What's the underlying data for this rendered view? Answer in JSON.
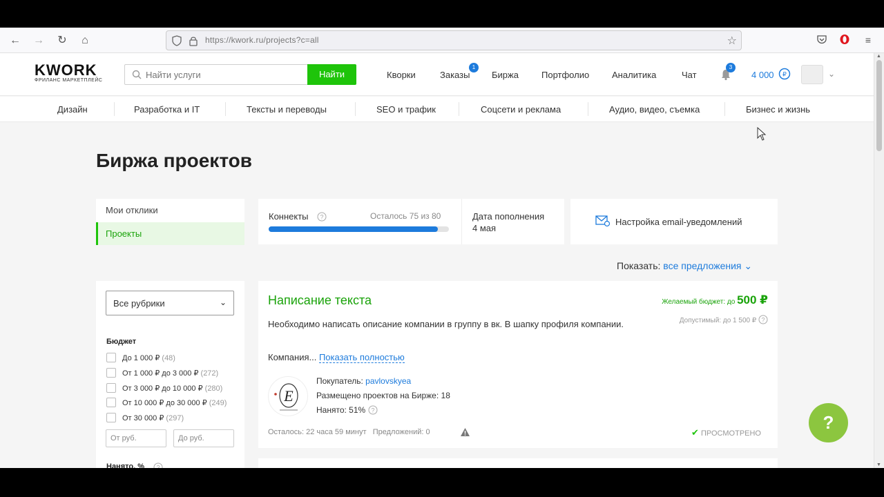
{
  "browser": {
    "url": "https://kwork.ru/projects?c=all"
  },
  "header": {
    "logo_main": "KWORK",
    "logo_sub": "ФРИЛАНС МАРКЕТПЛЕЙС",
    "search_placeholder": "Найти услуги",
    "search_button": "Найти",
    "nav": [
      {
        "label": "Кворки"
      },
      {
        "label": "Заказы",
        "badge": "1"
      },
      {
        "label": "Биржа"
      },
      {
        "label": "Портфолио"
      },
      {
        "label": "Аналитика"
      },
      {
        "label": "Чат"
      }
    ],
    "notifications_badge": "3",
    "balance": "4 000"
  },
  "categories": [
    "Дизайн",
    "Разработка и IT",
    "Тексты и переводы",
    "SEO и трафик",
    "Соцсети и реклама",
    "Аудио, видео, съемка",
    "Бизнес и жизнь"
  ],
  "page": {
    "title": "Биржа проектов"
  },
  "left_menu": {
    "items": [
      {
        "label": "Мои отклики"
      },
      {
        "label": "Проекты"
      }
    ]
  },
  "connects": {
    "label": "Коннекты",
    "remaining_text": "Осталось 75 из 80",
    "fill_fraction": 0.9375,
    "refill_label": "Дата пополнения",
    "refill_date": "4 мая"
  },
  "email_settings": {
    "label": "Настройка email-уведомлений"
  },
  "show_filter": {
    "label": "Показать:",
    "value": "все предложения"
  },
  "filters": {
    "rubric": "Все рубрики",
    "budget_heading": "Бюджет",
    "budget_options": [
      {
        "label": "До 1 000 ₽",
        "count": "(48)"
      },
      {
        "label": "От 1 000 ₽ до 3 000 ₽",
        "count": "(272)"
      },
      {
        "label": "От 3 000 ₽ до 10 000 ₽",
        "count": "(280)"
      },
      {
        "label": "От 10 000 ₽ до 30 000 ₽",
        "count": "(249)"
      },
      {
        "label": "От 30 000 ₽",
        "count": "(297)"
      }
    ],
    "from_placeholder": "От руб.",
    "to_placeholder": "До руб.",
    "hired_heading": "Нанято, %"
  },
  "project": {
    "title": "Написание текста",
    "budget_label": "Желаемый бюджет: до",
    "budget_amount": "500 ₽",
    "allowed": "Допустимый: до 1 500 ₽",
    "description": "Необходимо написать описание компании в группу в вк. В шапку профиля компании.",
    "more_prefix": "Компания...",
    "more_link": "Показать полностью",
    "buyer_label": "Покупатель:",
    "buyer_name": "pavlovskyea",
    "placed": "Размещено проектов на Бирже: 18",
    "hired": "Нанято: 51%",
    "time_left": "Осталось: 22 часа 59 минут",
    "offers": "Предложений: 0",
    "viewed": "ПРОСМОТРЕНО"
  },
  "help_button": "?"
}
